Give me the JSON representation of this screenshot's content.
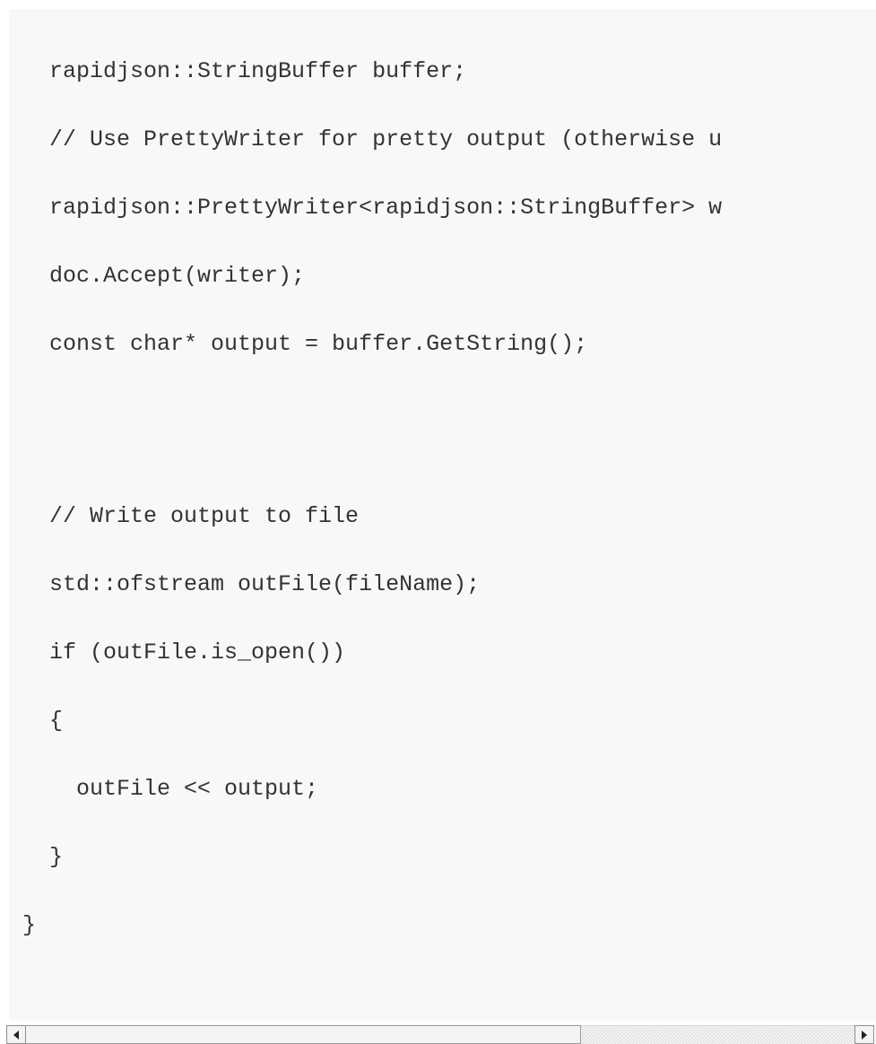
{
  "code": {
    "lines": [
      "   rapidjson::StringBuffer buffer;",
      "   // Use PrettyWriter for pretty output (otherwise u",
      "   rapidjson::PrettyWriter<rapidjson::StringBuffer> w",
      "   doc.Accept(writer);",
      "   const char* output = buffer.GetString();",
      "",
      "   // Write output to file",
      "   std::ofstream outFile(fileName);",
      "   if (outFile.is_open())",
      "   {",
      "     outFile << output;",
      "   }",
      " }"
    ]
  },
  "scrollbar": {
    "thumb_fraction": 0.67,
    "icons": {
      "left": "arrow-left-icon",
      "right": "arrow-right-icon"
    }
  }
}
